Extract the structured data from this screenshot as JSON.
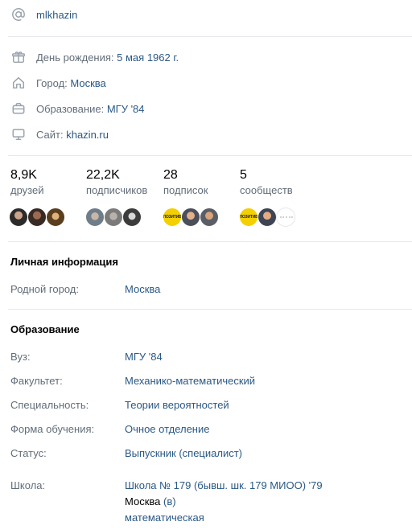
{
  "contacts": {
    "username": "mlkhazin",
    "birthday_label": "День рождения:",
    "birthday_value": "5 мая 1962 г.",
    "city_label": "Город:",
    "city_value": "Москва",
    "education_label": "Образование:",
    "education_value": "МГУ '84",
    "site_label": "Сайт:",
    "site_value": "khazin.ru"
  },
  "counters": [
    {
      "value": "8,9K",
      "label": "друзей"
    },
    {
      "value": "22,2K",
      "label": "подписчиков"
    },
    {
      "value": "28",
      "label": "подписок"
    },
    {
      "value": "5",
      "label": "сообществ"
    }
  ],
  "avatars": {
    "community_badge": "ПОЗИТИВ"
  },
  "personal": {
    "title": "Личная информация",
    "hometown_label": "Родной город:",
    "hometown_value": "Москва"
  },
  "education": {
    "title": "Образование",
    "uni_label": "Вуз:",
    "uni_value": "МГУ '84",
    "faculty_label": "Факультет:",
    "faculty_value": "Механико-математический",
    "specialty_label": "Специальность:",
    "specialty_value": "Теории вероятностей",
    "form_label": "Форма обучения:",
    "form_value": "Очное отделение",
    "status_label": "Статус:",
    "status_value": "Выпускник (специалист)",
    "school_label": "Школа:",
    "school_value": "Школа № 179 (бывш. шк. 179 МИОО) '79",
    "school_city": "Москва",
    "school_class": "(в)",
    "school_spec": "математическая"
  },
  "colors": {
    "link": "#2a5885",
    "label": "#626d7a",
    "divider": "#e7e8ec",
    "icon": "#99a2ad"
  }
}
